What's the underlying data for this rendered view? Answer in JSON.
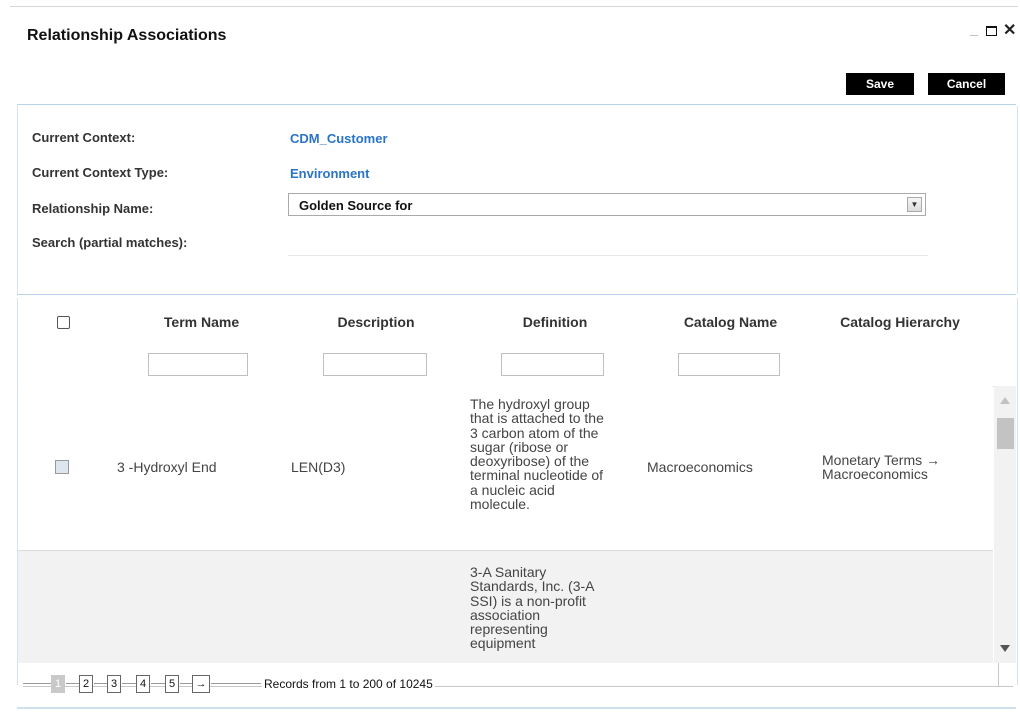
{
  "dialog": {
    "title": "Relationship Associations",
    "minimize_icon": "minimize-icon",
    "maximize_icon": "maximize-icon",
    "close_icon": "close-icon",
    "close_glyph": "✕"
  },
  "toolbar": {
    "save_label": "Save",
    "cancel_label": "Cancel"
  },
  "context": {
    "current_context_label": "Current Context:",
    "current_context_value": "CDM_Customer",
    "context_type_label": "Current Context Type:",
    "context_type_value": "Environment",
    "relationship_label": "Relationship Name:",
    "relationship_value": "Golden Source for",
    "search_label": "Search (partial matches):",
    "search_value": ""
  },
  "table": {
    "columns": [
      "Term Name",
      "Description",
      "Definition",
      "Catalog Name",
      "Catalog Hierarchy"
    ],
    "rows": [
      {
        "term_name": "3 -Hydroxyl End",
        "description": "LEN(D3)",
        "definition_lines": [
          "The hydroxyl group",
          "that is attached to the",
          "3 carbon atom of the",
          "sugar (ribose or",
          "deoxyribose) of the",
          "terminal nucleotide of",
          "a nucleic acid",
          "molecule."
        ],
        "catalog_name": "Macroeconomics",
        "catalog_hierarchy_lines": [
          "Monetary Terms →",
          "Macroeconomics"
        ]
      },
      {
        "term_name": "",
        "description": "",
        "definition_lines": [
          "3-A Sanitary",
          "Standards, Inc. (3-A",
          "SSI) is a non-profit",
          "association",
          "representing",
          "equipment"
        ],
        "catalog_name": "",
        "catalog_hierarchy_lines": []
      }
    ]
  },
  "pager": {
    "pages": [
      "1",
      "2",
      "3",
      "4",
      "5"
    ],
    "active_page": "1",
    "next_glyph": "→",
    "records_text": "Records from 1 to 200 of 10245"
  },
  "colors": {
    "accent": "#2a74c8",
    "button_bg": "#000000",
    "separator": "#b8d3ea"
  }
}
